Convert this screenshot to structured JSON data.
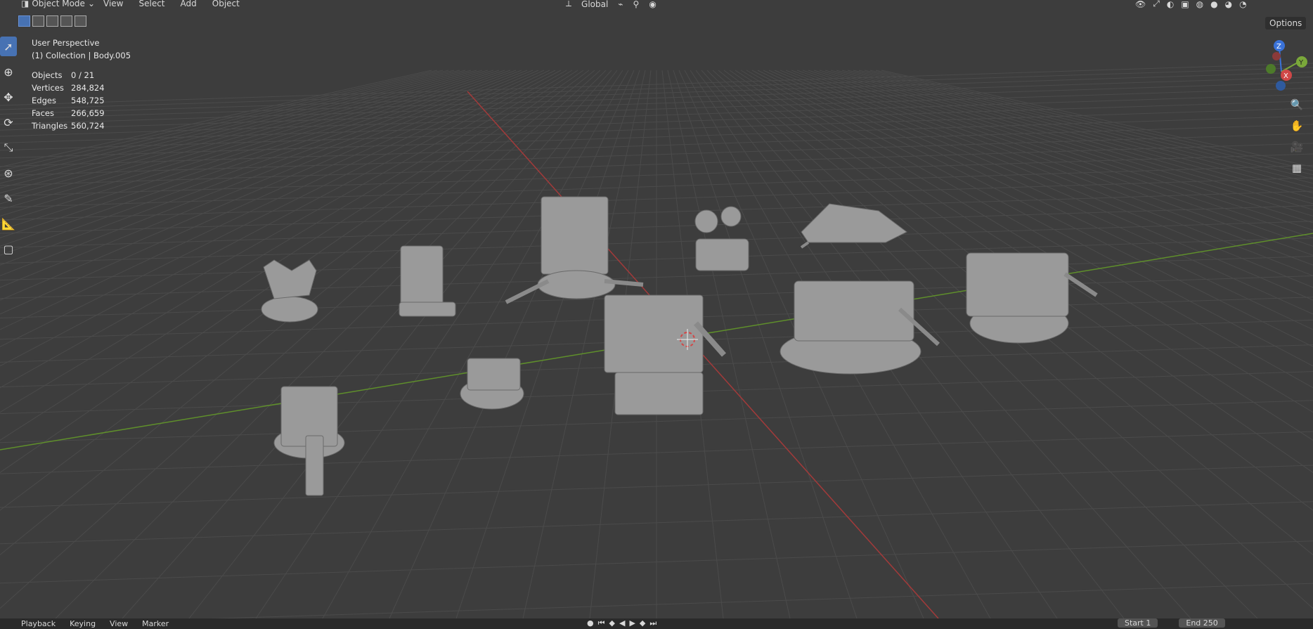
{
  "header": {
    "mode_label": "Object Mode",
    "menu": [
      "View",
      "Select",
      "Add",
      "Object"
    ],
    "transform_orientation": "Global",
    "options_label": "Options"
  },
  "viewport": {
    "view_name": "User Perspective",
    "collection_line": "(1) Collection | Body.005",
    "stats": [
      {
        "label": "Objects",
        "value": "0 / 21"
      },
      {
        "label": "Vertices",
        "value": "284,824"
      },
      {
        "label": "Edges",
        "value": "548,725"
      },
      {
        "label": "Faces",
        "value": "266,659"
      },
      {
        "label": "Triangles",
        "value": "560,724"
      }
    ],
    "gizmo": {
      "z": "Z",
      "y": "Y",
      "x": "X"
    }
  },
  "toolbar_icons": [
    "select-box-icon",
    "cursor-icon",
    "move-icon",
    "rotate-icon",
    "scale-icon",
    "transform-icon",
    "annotate-icon",
    "measure-icon",
    "add-cube-icon"
  ],
  "nav_icons": [
    "zoom-icon",
    "hand-pan-icon",
    "camera-icon",
    "ortho-grid-icon"
  ],
  "timeline": {
    "menus": [
      "Playback",
      "Keying",
      "View",
      "Marker"
    ],
    "start_label": "Start",
    "start_value": "1",
    "end_label": "End",
    "end_value": "250"
  },
  "colors": {
    "background": "#3d3d3d",
    "grid": "#4a4a4a",
    "x_axis": "#b03a3a",
    "y_axis": "#6b9a2e",
    "accent": "#4772b3",
    "model": "#9c9c9c"
  }
}
